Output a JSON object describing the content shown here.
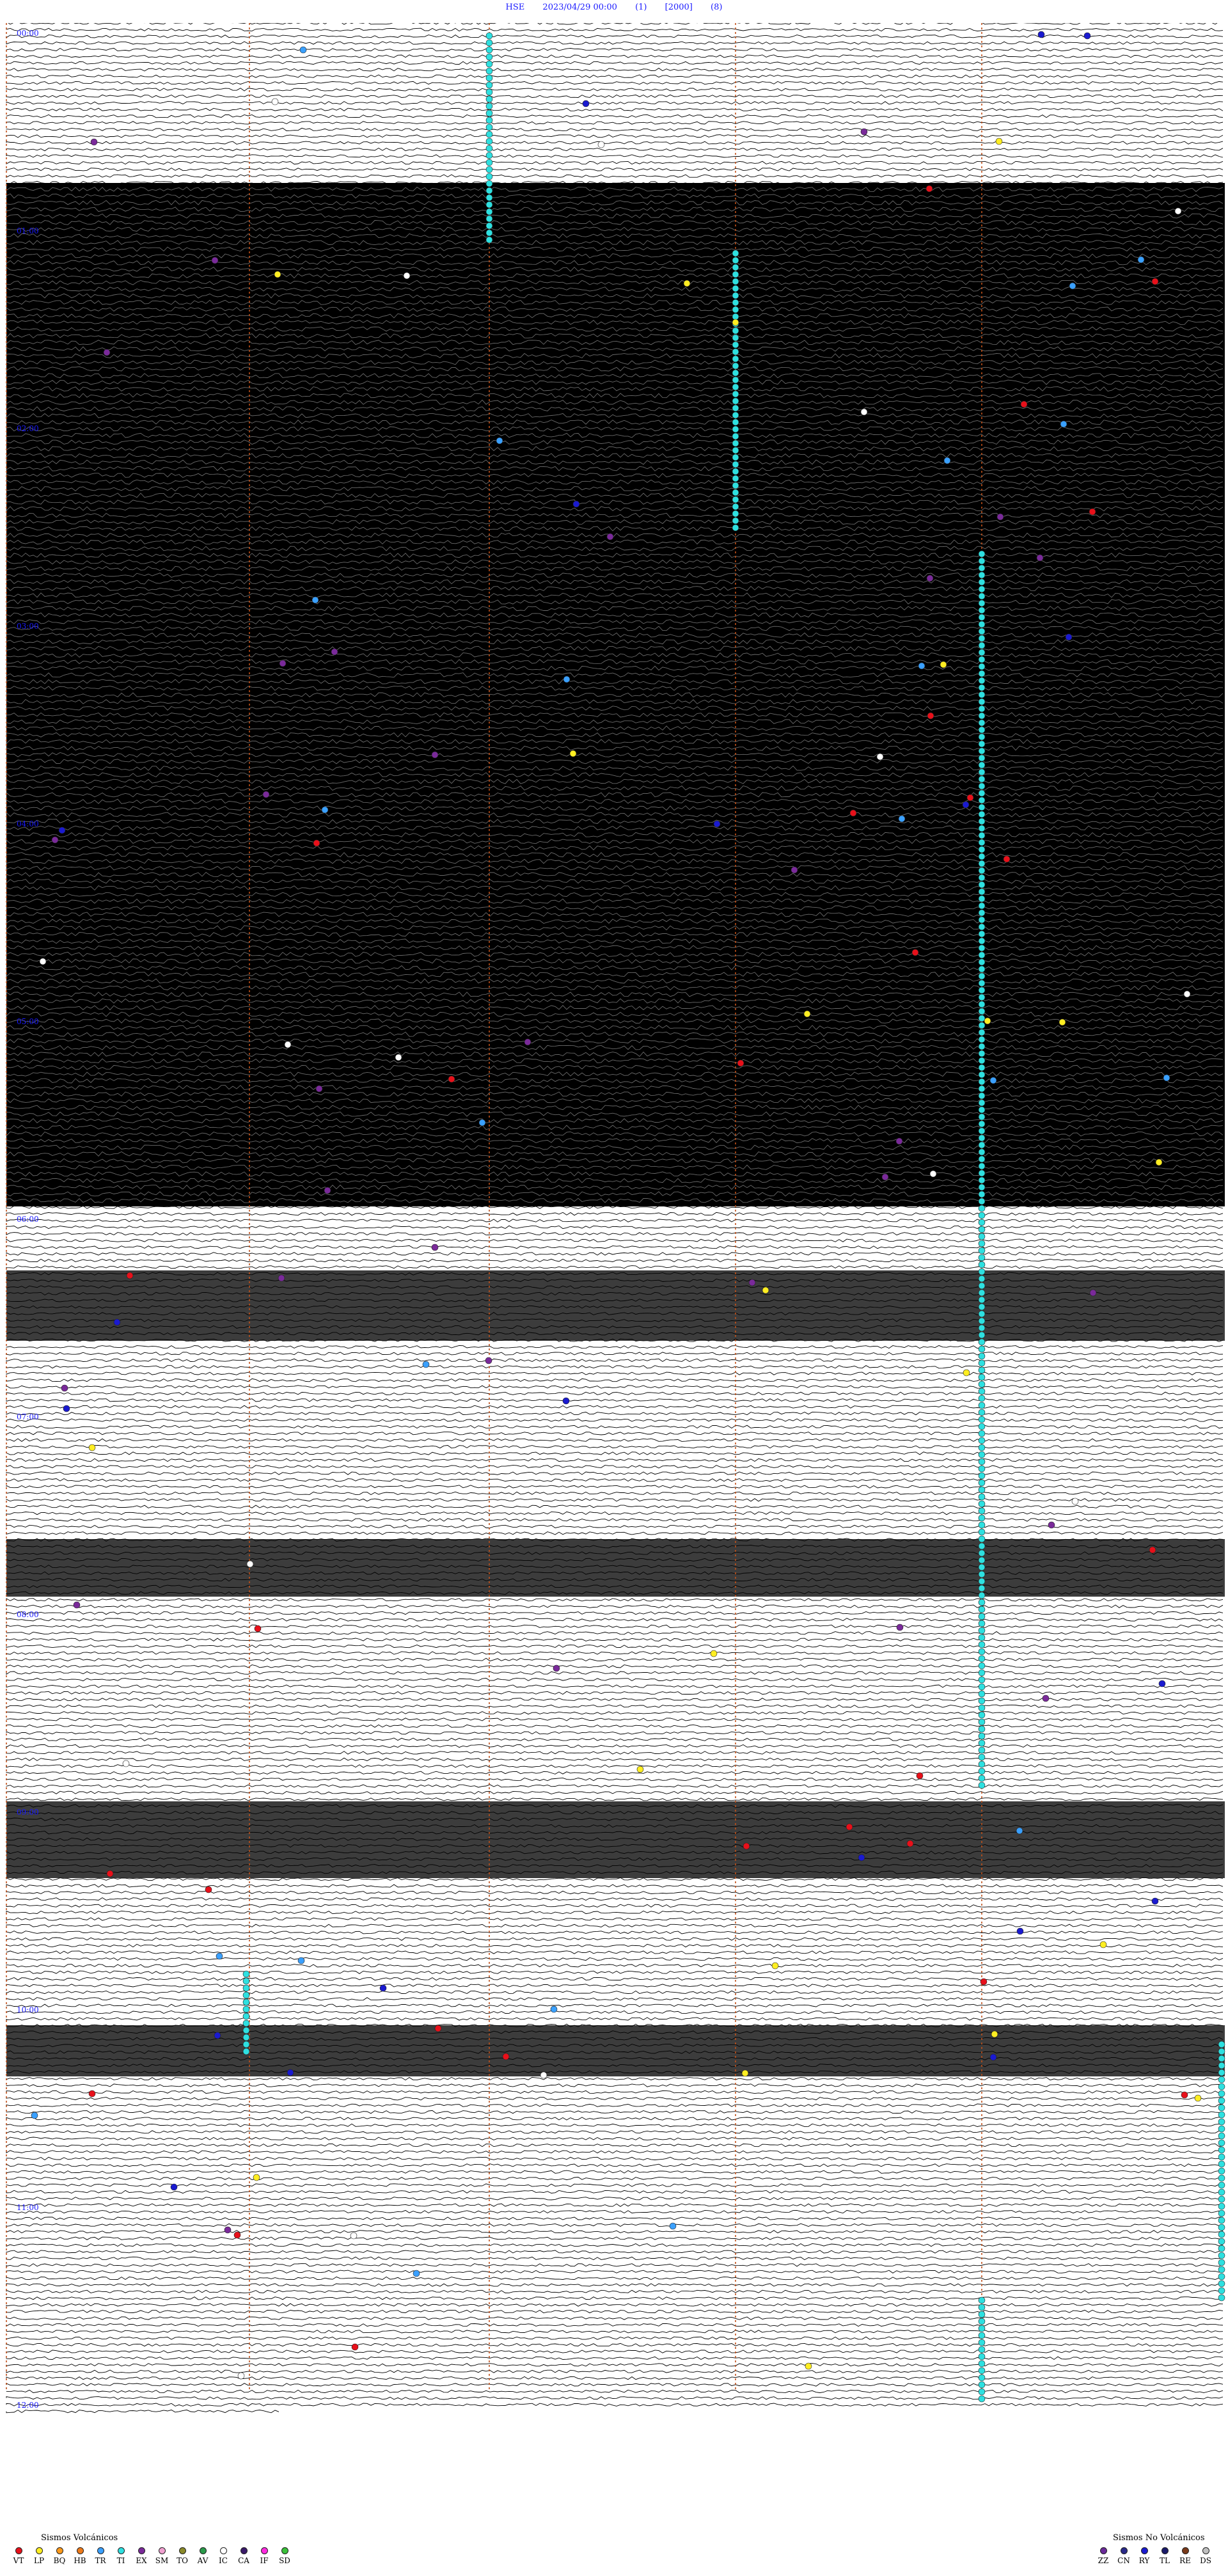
{
  "header": {
    "station": "HSE",
    "datetime": "2023/04/29 00:00",
    "field1": "(1)",
    "field2": "[2000]",
    "field3": "(8)"
  },
  "time_labels": [
    "00:00",
    "01:00",
    "02:00",
    "03:00",
    "04:00",
    "05:00",
    "06:00",
    "07:00",
    "08:00",
    "09:00",
    "10:00",
    "11:00",
    "12:00"
  ],
  "legend_volcanic": {
    "title": "Sismos Volcánicos",
    "items": [
      {
        "code": "VT",
        "color": "#e8101a"
      },
      {
        "code": "LP",
        "color": "#ffee22"
      },
      {
        "code": "BQ",
        "color": "#ff9a1a"
      },
      {
        "code": "HB",
        "color": "#ee7a1a"
      },
      {
        "code": "TR",
        "color": "#3aa0ff"
      },
      {
        "code": "TI",
        "color": "#2ee0e0"
      },
      {
        "code": "EX",
        "color": "#7a2a9a"
      },
      {
        "code": "SM",
        "color": "#f0a0d0"
      },
      {
        "code": "TO",
        "color": "#8a8a2a"
      },
      {
        "code": "AV",
        "color": "#2a9a4a"
      },
      {
        "code": "IC",
        "color": "#ffffff"
      },
      {
        "code": "CA",
        "color": "#3a1a6a"
      },
      {
        "code": "IF",
        "color": "#ff2ae0"
      },
      {
        "code": "SD",
        "color": "#3ac03a"
      }
    ]
  },
  "legend_nonvolcanic": {
    "title": "Sismos No Volcánicos",
    "items": [
      {
        "code": "ZZ",
        "color": "#6a2a9a"
      },
      {
        "code": "CN",
        "color": "#2a2a8a"
      },
      {
        "code": "RY",
        "color": "#1a1ad0"
      },
      {
        "code": "TL",
        "color": "#1a1a6a"
      },
      {
        "code": "RE",
        "color": "#7a3a1a"
      },
      {
        "code": "DS",
        "color": "#c0c0c0"
      }
    ]
  },
  "colors": {
    "label_blue": "#1a1aff",
    "trace": "#000000",
    "minute_marker": "#c0501a",
    "tremor_cyan": "#2ee0e0"
  }
}
